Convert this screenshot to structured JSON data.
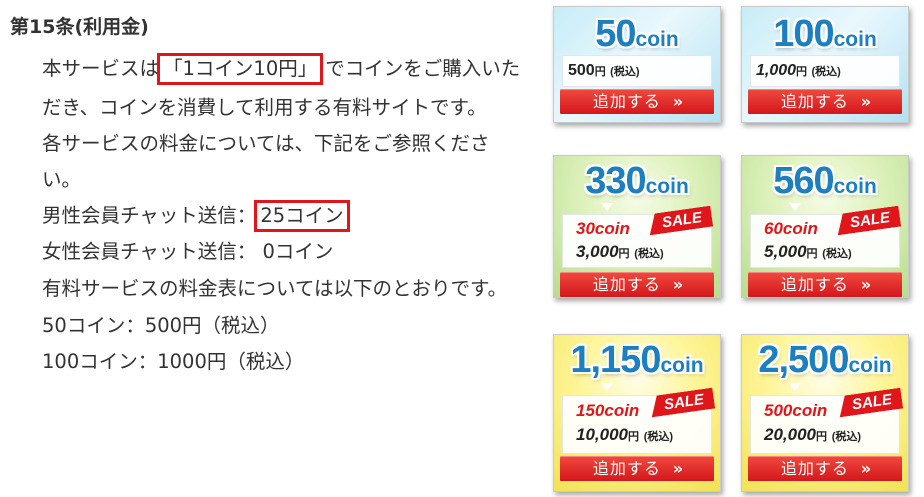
{
  "article": {
    "title": "第15条(利用金)",
    "lines": {
      "l1_pre": "本サービスは",
      "l1_hl": "「1コイン10円」",
      "l1_post": "でコインをご購入いた",
      "l2": "だき、コインを消費して利用する有料サイトです。",
      "l3": "各サービスの料金については、下記をご参照くださ",
      "l4": "い。",
      "l5_pre": "男性会員チャット送信：",
      "l5_hl": "25コイン",
      "l6": "女性会員チャット送信： 0コイン",
      "l7": "有料サービスの料金表については以下のとおりです。",
      "l8": "50コイン：500円（税込）",
      "l9": "100コイン：1000円（税込）"
    }
  },
  "highlight_color": "#e0161b",
  "coin_unit": "coin",
  "add_label": "追加する",
  "chevron": "»",
  "sale_label": "SALE",
  "yen_label": "円",
  "tax_label": "(税込)",
  "packages": [
    {
      "amount": "50",
      "price": "500",
      "color": "#1e7fc0"
    },
    {
      "amount": "100",
      "price": "1,000",
      "color": "#1e7fc0"
    },
    {
      "amount": "330",
      "bonus": "30coin",
      "price": "3,000",
      "color": "#1e7fc0"
    },
    {
      "amount": "560",
      "bonus": "60coin",
      "price": "5,000",
      "color": "#1e7fc0"
    },
    {
      "amount": "1,150",
      "bonus": "150coin",
      "price": "10,000",
      "color": "#1e7fc0"
    },
    {
      "amount": "2,500",
      "bonus": "500coin",
      "price": "20,000",
      "color": "#1e7fc0"
    }
  ]
}
